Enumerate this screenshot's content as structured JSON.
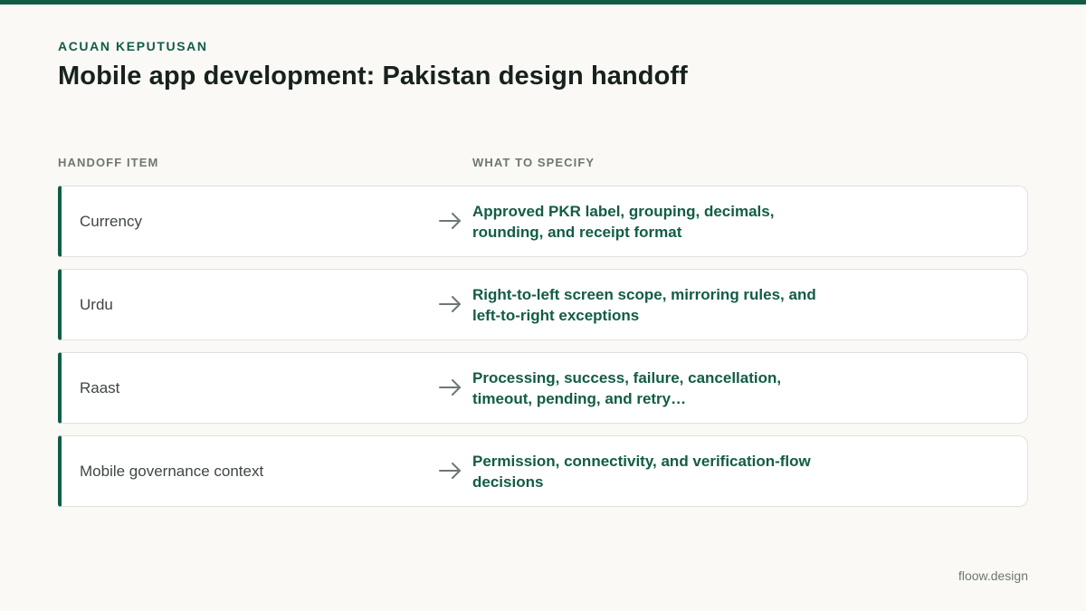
{
  "colors": {
    "accent": "#125c46",
    "background": "#faf9f6"
  },
  "header": {
    "eyebrow": "ACUAN KEPUTUSAN",
    "title": "Mobile app development: Pakistan design handoff"
  },
  "table": {
    "columns": [
      "HANDOFF ITEM",
      "WHAT TO SPECIFY"
    ],
    "rows": [
      {
        "item": "Currency",
        "spec": "Approved PKR label, grouping, decimals, rounding, and receipt format"
      },
      {
        "item": "Urdu",
        "spec": "Right-to-left screen scope, mirroring rules, and left-to-right exceptions"
      },
      {
        "item": "Raast",
        "spec": "Processing, success, failure, cancellation, timeout, pending, and retry…"
      },
      {
        "item": "Mobile governance context",
        "spec": "Permission, connectivity, and verification-flow decisions"
      }
    ]
  },
  "icons": {
    "row_arrow": "arrow-right-icon"
  },
  "footer": {
    "brand": "floow.design"
  }
}
